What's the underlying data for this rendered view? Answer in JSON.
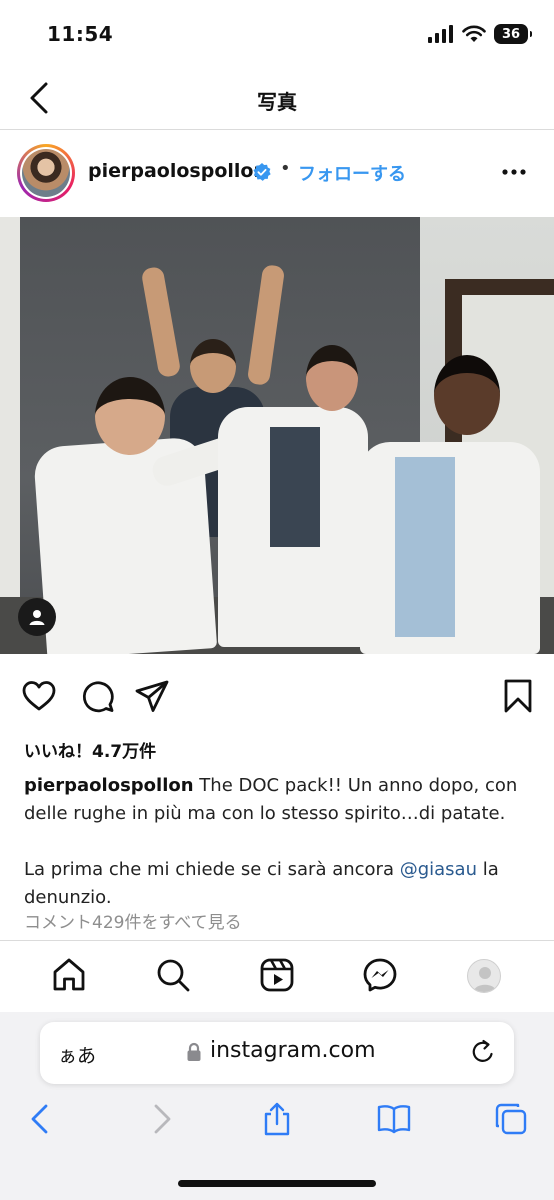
{
  "status": {
    "time": "11:54",
    "battery": "36"
  },
  "nav": {
    "title": "写真"
  },
  "post": {
    "username": "pierpaolospollon",
    "separator": "•",
    "follow_label": "フォローする"
  },
  "likes": "いいね！4.7万件",
  "caption": {
    "username": "pierpaolospollon",
    "text1": " The DOC pack!! Un anno dopo, con delle rughe in più ma con lo stesso spirito…di patate.",
    "text2_before": "La prima che mi chiede se ci sarà ancora ",
    "mention": "@giasau",
    "text2_after": " la denunzio."
  },
  "comments_link": "コメント429件をすべて見る",
  "safari": {
    "text_size_label": "ぁあ",
    "url": "instagram.com"
  },
  "colors": {
    "accent": "#3897f0",
    "safari_blue": "#2f7cf6",
    "mention": "#2a5a8f"
  },
  "icons": [
    "signal-icon",
    "wifi-icon",
    "battery-icon",
    "back-icon",
    "verified-badge-icon",
    "more-icon",
    "heart-icon",
    "comment-icon",
    "share-icon",
    "bookmark-icon",
    "home-icon",
    "search-icon",
    "reels-icon",
    "messenger-icon",
    "profile-avatar",
    "lock-icon",
    "reload-icon",
    "chevron-left-icon",
    "chevron-right-icon",
    "share-sheet-icon",
    "bookmarks-icon",
    "tabs-icon",
    "user-tag-icon"
  ]
}
